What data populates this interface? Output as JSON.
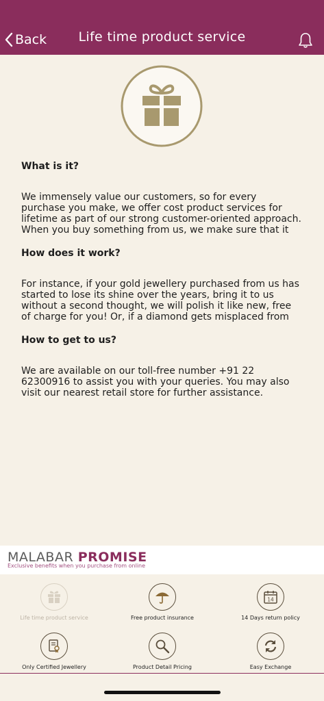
{
  "header": {
    "back_label": "Back",
    "title": "Life time product service",
    "background": "#8a2d5c"
  },
  "hero": {
    "icon": "gift-icon",
    "color": "#a8996e"
  },
  "sections": [
    {
      "heading": "What is it?",
      "body": "We immensely value our customers, so for every purchase you make, we offer cost product services for lifetime as part of our strong customer-oriented approach. When you buy something from us, we make sure that it stays with you as a keepsake forever and"
    },
    {
      "heading": "How does it work?",
      "body": "For instance, if your gold jewellery purchased from us has started to lose its shine over the years, bring it to us without a second thought, we will polish it like new, free of charge for you! Or, if a diamond gets misplaced from your diamond jewellery, it will be replaced without any"
    },
    {
      "heading": "How to get to us?",
      "body": "We are available on our toll-free number +91 22 62300916 to assist you with your queries. You may also visit our nearest retail store for further assistance."
    }
  ],
  "promise": {
    "title_part1": "MALABAR",
    "title_part2": "PROMISE",
    "subtitle": "Exclusive benefits when you purchase from online",
    "accent": "#8a2d5c"
  },
  "benefits": [
    {
      "label": "Life time product service",
      "icon": "gift-icon",
      "active": true
    },
    {
      "label": "Free product insurance",
      "icon": "umbrella-icon",
      "active": false
    },
    {
      "label": "14 Days return policy",
      "icon": "calendar-icon",
      "day": "14",
      "active": false
    },
    {
      "label": "Only Certified Jewellery",
      "icon": "certificate-icon",
      "active": false
    },
    {
      "label": "Product Detail Pricing",
      "icon": "magnifier-icon",
      "active": false
    },
    {
      "label": "Easy Exchange",
      "icon": "exchange-icon",
      "active": false
    }
  ]
}
